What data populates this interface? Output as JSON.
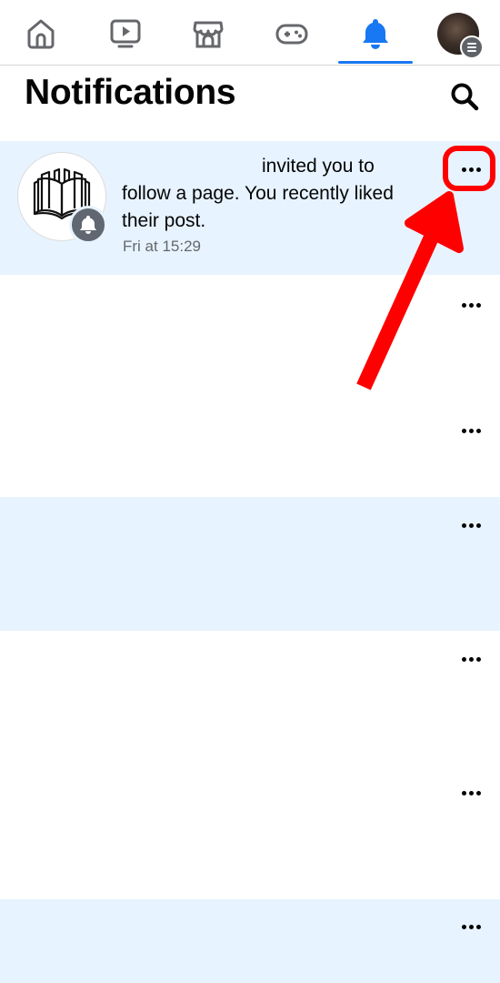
{
  "nav": {
    "tabs": [
      {
        "name": "home",
        "icon": "home-icon",
        "active": false
      },
      {
        "name": "watch",
        "icon": "video-icon",
        "active": false
      },
      {
        "name": "marketplace",
        "icon": "marketplace-icon",
        "active": false
      },
      {
        "name": "gaming",
        "icon": "gaming-icon",
        "active": false
      },
      {
        "name": "notifications",
        "icon": "bell-icon",
        "active": true
      },
      {
        "name": "profile-menu",
        "icon": "avatar",
        "active": false
      }
    ],
    "active_color": "#1877f2",
    "inactive_color": "#65676b"
  },
  "header": {
    "title": "Notifications",
    "search_icon": "search-icon"
  },
  "notifications": [
    {
      "line1": "invited you to",
      "line2": "follow a page. You recently liked",
      "line3": "their post.",
      "time": "Fri at 15:29",
      "avatar_icon": "open-book-icon",
      "badge_icon": "bell-icon",
      "unread": true
    }
  ],
  "more_icon": "more-dots-icon",
  "colors": {
    "unread_bg": "#e7f3ff",
    "annotation": "#ff0000"
  }
}
